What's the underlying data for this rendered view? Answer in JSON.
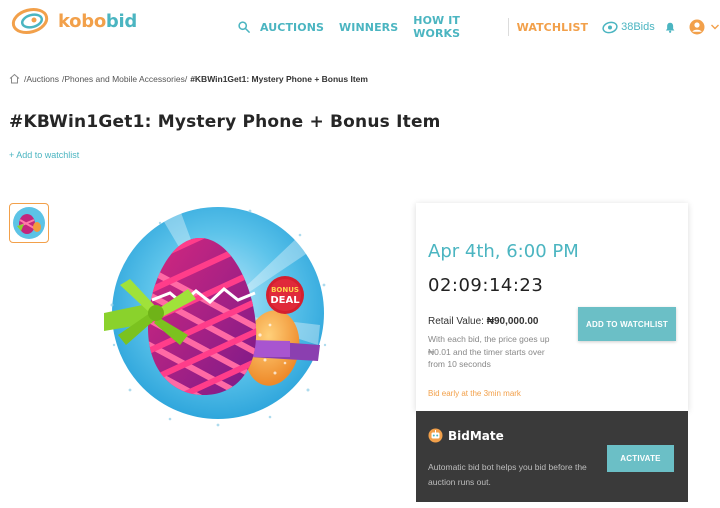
{
  "header": {
    "logo_part1": "kobo",
    "logo_part2": "bid",
    "nav": [
      "AUCTIONS",
      "WINNERS",
      "HOW IT WORKS"
    ],
    "watchlist": "WATCHLIST",
    "bids": "38Bids"
  },
  "breadcrumb": {
    "items": [
      "/Auctions",
      "/Phones and Mobile Accessories/",
      "#KBWin1Get1: Mystery Phone + Bonus Item"
    ]
  },
  "product": {
    "title": "#KBWin1Get1: Mystery Phone + Bonus Item",
    "add_watchlist": "+ Add to watchlist",
    "badge_line1": "BONUS",
    "badge_line2": "DEAL"
  },
  "auction": {
    "date": "Apr 4th, 6:00 PM",
    "timer": "02:09:14:23",
    "retail_label": "Retail Value:",
    "retail_value": "₦90,000.00",
    "rule": "With each bid, the price goes up ₦0.01 and the timer starts over from 10 seconds",
    "early_note": "Bid early at the 3min mark",
    "watch_button": "ADD TO WATCHLIST"
  },
  "bidmate": {
    "title": "BidMate",
    "description": "Automatic bid bot helps you bid before the auction runs out.",
    "button": "ACTIVATE"
  },
  "colors": {
    "teal": "#4bb5c1",
    "orange": "#f2a04a",
    "button": "#6bbfc6",
    "dark_panel": "#3a3a3a"
  }
}
